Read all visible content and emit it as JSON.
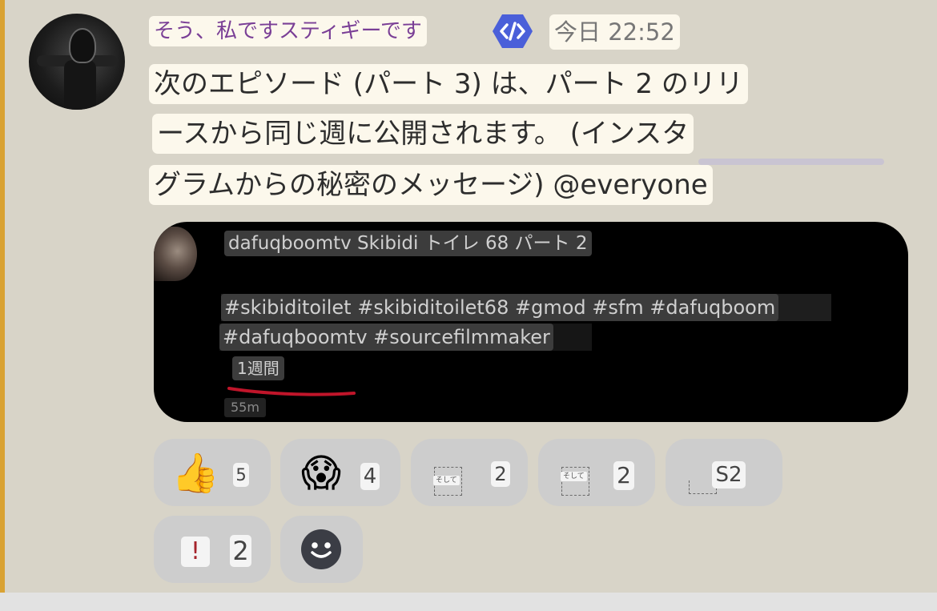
{
  "message": {
    "author": "そう、私ですスティギーです",
    "timestamp": "今日 22:52",
    "lines": [
      "次のエピソード (パート 3) は、パート 2 のリリ",
      "ースから同じ週に公開されます。 (インスタ",
      "グラムからの秘密のメッセージ) @everyone"
    ]
  },
  "embed": {
    "title": "dafuqboomtv Skibidi トイレ 68 パート 2",
    "tags_line1": "#skibiditoilet #skibiditoilet68 #gmod #sfm #dafuqboom",
    "tags_line2": "#dafuqboomtv #sourcefilmmaker",
    "age": "1週間",
    "duration": "55m"
  },
  "reactions": [
    {
      "emoji": "👍",
      "count": "5"
    },
    {
      "emoji": "😱",
      "count": "4"
    },
    {
      "emoji": "そして",
      "count": "2"
    },
    {
      "emoji": "そして",
      "count": "2"
    },
    {
      "emoji": "",
      "count": "S2"
    },
    {
      "emoji": "!",
      "count": "2"
    }
  ],
  "colors": {
    "accent_bar": "#d9a233",
    "username": "#7a3f96",
    "app_badge": "#4a5fd9",
    "embed_bg": "#000000",
    "reaction_bg": "#cdcdcd",
    "underline": "#c0152a"
  },
  "icons": {
    "app_badge": "code-brackets-icon",
    "add_reaction": "smiley-face-icon"
  }
}
